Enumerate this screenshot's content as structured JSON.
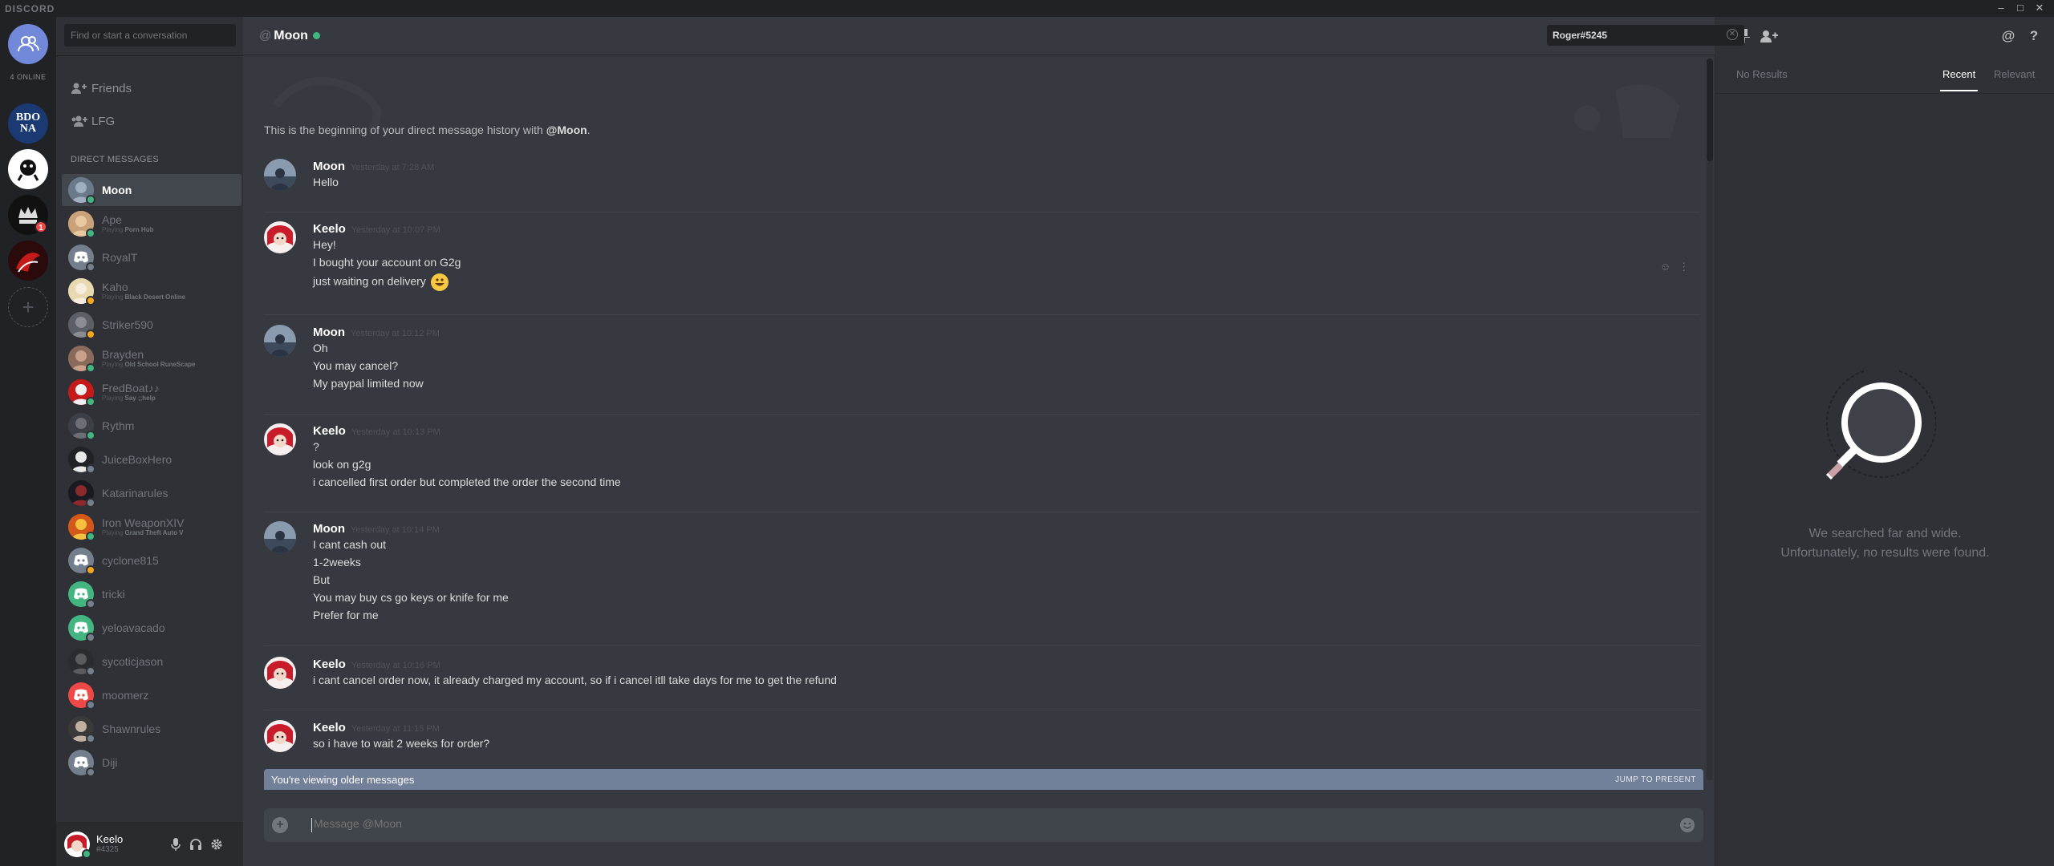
{
  "app": {
    "brand": "DISCORD",
    "window_controls": [
      "–",
      "□",
      "✕"
    ]
  },
  "guilds": {
    "online_label": "4 ONLINE",
    "items": [
      {
        "name": "Friends Home",
        "icon": "friends-icon"
      },
      {
        "name": "BDO NA",
        "icon": "bdo-na-icon",
        "text": "BDO NA"
      },
      {
        "name": "Server 2",
        "icon": "server-icon"
      },
      {
        "name": "Server 3",
        "icon": "crown-server-icon",
        "badge": "1"
      },
      {
        "name": "Server 4",
        "icon": "server-icon"
      },
      {
        "name": "Add Server",
        "icon": "plus-icon"
      }
    ]
  },
  "dm_panel": {
    "search_placeholder": "Find or start a conversation",
    "nav": [
      {
        "label": "Friends",
        "icon": "friends-icon"
      },
      {
        "label": "LFG",
        "icon": "lfg-icon"
      }
    ],
    "section_header": "DIRECT MESSAGES",
    "items": [
      {
        "name": "Moon",
        "status": "online",
        "activity_prefix": "",
        "activity": "",
        "active": true
      },
      {
        "name": "Ape",
        "status": "online",
        "activity_prefix": "Playing",
        "activity": "Porn Hub"
      },
      {
        "name": "RoyalT",
        "status": "offline",
        "activity_prefix": "",
        "activity": ""
      },
      {
        "name": "Kaho",
        "status": "idle",
        "activity_prefix": "Playing",
        "activity": "Black Desert Online"
      },
      {
        "name": "Striker590",
        "status": "idle",
        "activity_prefix": "",
        "activity": ""
      },
      {
        "name": "Brayden",
        "status": "online",
        "activity_prefix": "Playing",
        "activity": "Old School RuneScape"
      },
      {
        "name": "FredBoat♪♪",
        "status": "online",
        "activity_prefix": "Playing",
        "activity": "Say ;;help"
      },
      {
        "name": "Rythm",
        "status": "online",
        "activity_prefix": "",
        "activity": ""
      },
      {
        "name": "JuiceBoxHero",
        "status": "offline",
        "activity_prefix": "",
        "activity": ""
      },
      {
        "name": "Katarinarules",
        "status": "offline",
        "activity_prefix": "",
        "activity": ""
      },
      {
        "name": "Iron WeaponXIV",
        "status": "online",
        "activity_prefix": "Playing",
        "activity": "Grand Theft Auto V"
      },
      {
        "name": "cyclone815",
        "status": "idle",
        "activity_prefix": "",
        "activity": ""
      },
      {
        "name": "tricki",
        "status": "offline",
        "activity_prefix": "",
        "activity": ""
      },
      {
        "name": "yeloavacado",
        "status": "offline",
        "activity_prefix": "",
        "activity": ""
      },
      {
        "name": "sycoticjason",
        "status": "offline",
        "activity_prefix": "",
        "activity": ""
      },
      {
        "name": "moomerz",
        "status": "offline",
        "activity_prefix": "",
        "activity": ""
      },
      {
        "name": "Shawnrules",
        "status": "offline",
        "activity_prefix": "",
        "activity": ""
      },
      {
        "name": "Diji",
        "status": "offline",
        "activity_prefix": "",
        "activity": ""
      }
    ]
  },
  "user_panel": {
    "username": "Keelo",
    "tag": "#4325"
  },
  "chat": {
    "header": {
      "at": "@",
      "title": "Moon"
    },
    "beginning_prefix": "This is the beginning of your direct message history with ",
    "beginning_name": "@Moon",
    "beginning_suffix": ".",
    "messages": [
      {
        "author": "Moon",
        "time": "Yesterday at 7:28 AM",
        "lines": [
          "Hello"
        ]
      },
      {
        "author": "Keelo",
        "time": "Yesterday at 10:07 PM",
        "lines": [
          "Hey!",
          "I bought your account on G2g",
          "just waiting on delivery"
        ]
      },
      {
        "author": "Moon",
        "time": "Yesterday at 10:12 PM",
        "lines": [
          "Oh",
          "You may cancel?",
          "My paypal limited now"
        ]
      },
      {
        "author": "Keelo",
        "time": "Yesterday at 10:13 PM",
        "lines": [
          "?",
          "look on g2g",
          "i cancelled first order but completed the order the second time"
        ]
      },
      {
        "author": "Moon",
        "time": "Yesterday at 10:14 PM",
        "lines": [
          "I cant cash out",
          "1-2weeks",
          "But",
          "You may buy cs go keys or knife for me",
          "Prefer for me"
        ]
      },
      {
        "author": "Keelo",
        "time": "Yesterday at 10:16 PM",
        "lines": [
          "i cant cancel order now, it already charged my account, so if i cancel itll take days for me to get the refund"
        ]
      },
      {
        "author": "Keelo",
        "time": "Yesterday at 11:15 PM",
        "lines": [
          "so i have to wait 2 weeks for order?"
        ]
      }
    ],
    "older_notice": "You're viewing older messages",
    "jump_label": "JUMP TO PRESENT",
    "composer_placeholder": "Message @Moon"
  },
  "search": {
    "query": "Roger#5245",
    "no_results_label": "No Results",
    "tabs": [
      "Recent",
      "Relevant"
    ],
    "empty_line1": "We searched far and wide.",
    "empty_line2": "Unfortunately, no results were found."
  },
  "colors": {
    "online": "#43b581",
    "idle": "#faa61a",
    "offline": "#747f8d",
    "blurple": "#7289da",
    "badge": "#f04747"
  }
}
